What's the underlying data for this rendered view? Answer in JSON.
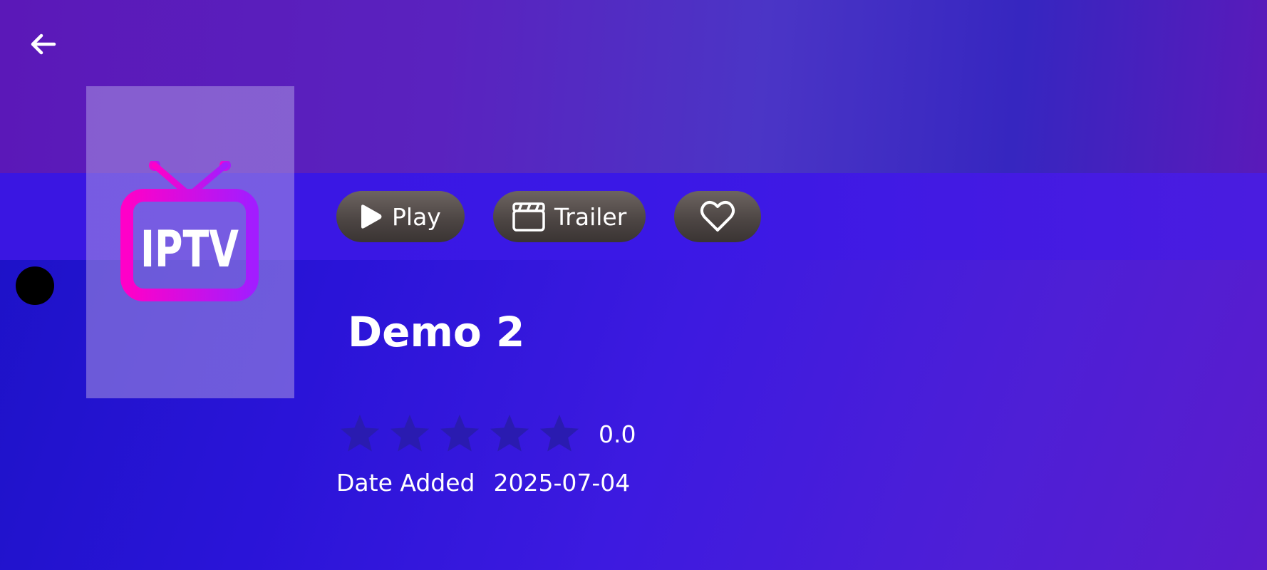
{
  "header": {
    "back_icon": "arrow-left-icon"
  },
  "poster": {
    "logo_text": "IPTV",
    "brand_colors": [
      "#ff00c8",
      "#b31cff"
    ]
  },
  "actions": {
    "play_label": "Play",
    "trailer_label": "Trailer",
    "favorite_icon": "heart-outline-icon"
  },
  "movie": {
    "title": "Demo 2",
    "rating_value": "0.0",
    "rating_stars_filled": 0,
    "rating_stars_total": 5,
    "date_added_label": "Date Added",
    "date_added_value": "2025-07-04"
  },
  "colors": {
    "accent_text": "#ffffff",
    "star_empty": "#2a1bb0",
    "pill_bg": "#4b4442"
  }
}
